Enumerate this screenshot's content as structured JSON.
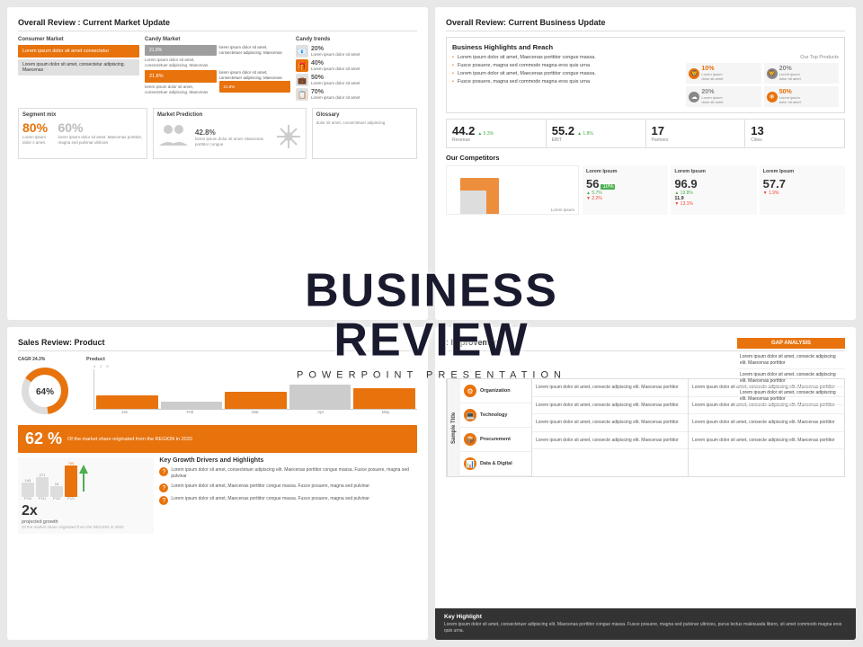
{
  "slides": {
    "slide1": {
      "title": "Overall Review : Current Market Update",
      "consumer_market_label": "Consumer Market",
      "candy_market_label": "Candy Market",
      "candy_trends_label": "Candy trends",
      "pct1": "21.8%",
      "pct2": "21.8%",
      "pct3": "21.8%",
      "pct4": "20%",
      "pct5": "40%",
      "pct6": "50%",
      "pct7": "70%",
      "lorem_short": "Lorem ipsum dolor sit amet, consecte adipiscing",
      "lorem_short2": "lorem ipsum dolor sit amet, consectetuer adipiscing. Maecenas",
      "segment_mix": "Segment mix",
      "market_prediction": "Market Prediction",
      "glossary": "Glossary",
      "big_pct1": "80%",
      "big_pct2": "60%",
      "market_val": "42.8%",
      "glossary_text": "dolor sit amet, consectetuer adipiscing"
    },
    "slide2": {
      "title": "Overall Review: Current Business Update",
      "highlights_title": "Business Highlights and Reach",
      "bullets": [
        "Lorem ipsum dolor sit amet, Maecenas porttitor congue massa.",
        "Fusce posuere, magna sed commodo magna eros quis urna",
        "Lorem ipsum dolor sit amet, Maecenas porttitor congue massa.",
        "Fusce posuere, magna sed commodo magna eros quis urna"
      ],
      "top_products_label": "Our Top Products",
      "products": [
        {
          "icon": "🦁",
          "pct": "10%",
          "type": "orange"
        },
        {
          "icon": "🦁",
          "pct": "20%",
          "type": "gray"
        },
        {
          "icon": "☁",
          "pct": "20%",
          "type": "gray"
        },
        {
          "icon": "❄",
          "pct": "50%",
          "type": "orange"
        }
      ],
      "metrics": [
        {
          "val": "44.2",
          "label": "Revenue",
          "change": "5.3%",
          "positive": true
        },
        {
          "val": "55.2",
          "label": "EBIT",
          "change": "1.8%",
          "positive": true
        },
        {
          "val": "17",
          "label": "Partners",
          "change": "",
          "positive": true
        },
        {
          "val": "13",
          "label": "Cities",
          "change": "",
          "positive": true
        }
      ],
      "competitors_title": "Our Competitors",
      "comp_cols": [
        {
          "title": "Lorem Ipsum",
          "val": "56",
          "sub1": "5.7%",
          "sub2": "2.2%",
          "badge": "10%"
        },
        {
          "title": "Lorem Ipsum",
          "val": "96.9",
          "sub1": "19.8%",
          "sub2": "13.1%",
          "badge": ""
        },
        {
          "title": "Lorem Ipsum",
          "val": "57.7",
          "sub2": "1.9%",
          "sub1": ""
        },
        {
          "title": "Lorem Ipsum",
          "val": "11.9",
          "sub2": "",
          "sub1": ""
        }
      ]
    },
    "slide3": {
      "title": "Sales Review: Product",
      "cagr": "CAGR 24.3%",
      "donut_pct": "64%",
      "chart_title": "Product",
      "bar_months": [
        "Jan",
        "Feb",
        "Mar",
        "Apr",
        "May"
      ],
      "market_share_pct": "62 %",
      "market_share_text": "Of the market share originated from the REGION in 2020",
      "growth_val": "2x",
      "growth_label": "projected growth",
      "growth_sub": "Of the market share originated from the REGION in 2020",
      "highlights_title": "Key Growth Drivers and Highlights",
      "highlights": [
        {
          "title": "Lorem ipsum dolor sit amet, consectetuer adipiscing elit. Maecenas porttitor congue massa. Fusce posuere, magna sed pulvinar"
        },
        {
          "title": "Lorem ipsum dolor sit amet, Maecenas porttitor congue massa. Fusce posuere, magna sed pulvinar"
        },
        {
          "title": "Lorem ipsum dolor sit amet, Maecenas porttitor congue massa. Fusce posuere, magna sed pulvinar"
        }
      ],
      "bar_vals": [
        35,
        20,
        45,
        65,
        55
      ]
    },
    "slide4": {
      "title": ": Improvement",
      "gap_analysis_title": "GAP ANALYSIS",
      "gap_items": [
        "Lorem ipsum dolor sit amet, consecte adipiscing elit. Maecenas porttitor",
        "Lorem ipsum dolor sit amet, consecte adipiscing elit. Maecenas porttitor",
        "Lorem ipsum dolor sit amet, consecte adipiscing elit. Maecenas porttitor"
      ],
      "sample_title": "Sample Title",
      "categories": [
        {
          "icon": "⚙",
          "name": "Organization"
        },
        {
          "icon": "💻",
          "name": "Technology"
        },
        {
          "icon": "📦",
          "name": "Procurement"
        },
        {
          "icon": "📊",
          "name": "Data & Digital"
        }
      ],
      "desc_col1": [
        "Lorem ipsum dolor sit amet, consecte adipiscing elit. Maecenas porttitor",
        "Lorem ipsum dolor sit amet, consecte adipiscing elit. Maecenas porttitor",
        "Lorem ipsum dolor sit amet, consecte adipiscing elit. Maecenas porttitor",
        "Lorem ipsum dolor sit amet, consecte adipiscing elit. Maecenas porttitor"
      ],
      "desc_col2": [
        "Lorem ipsum dolor sit amet, consecte adipiscing elit. Maecenas porttitor",
        "Lorem ipsum dolor sit amet, consecte adipiscing elit. Maecenas porttitor",
        "Lorem ipsum dolor sit amet, consecte adipiscing elit. Maecenas porttitor",
        "Lorem ipsum dolor sit amet, consecte adipiscing elit. Maecenas porttitor"
      ],
      "key_highlight_title": "Key Highlight",
      "key_highlight_text": "Lorem ipsum dolor sit amet, consectetuer adipiscing elit. Maecenas porttitor congue massa. Fusce posuere, magna sed pulvinar ultricies, purus lectus malesuada libero, sit amet commodo magna eros quis urna."
    }
  },
  "overlay": {
    "main_title_line1": "BUSINESS",
    "main_title_line2": "REVIEW",
    "sub_title": "POWERPOINT PRESENTATION"
  }
}
